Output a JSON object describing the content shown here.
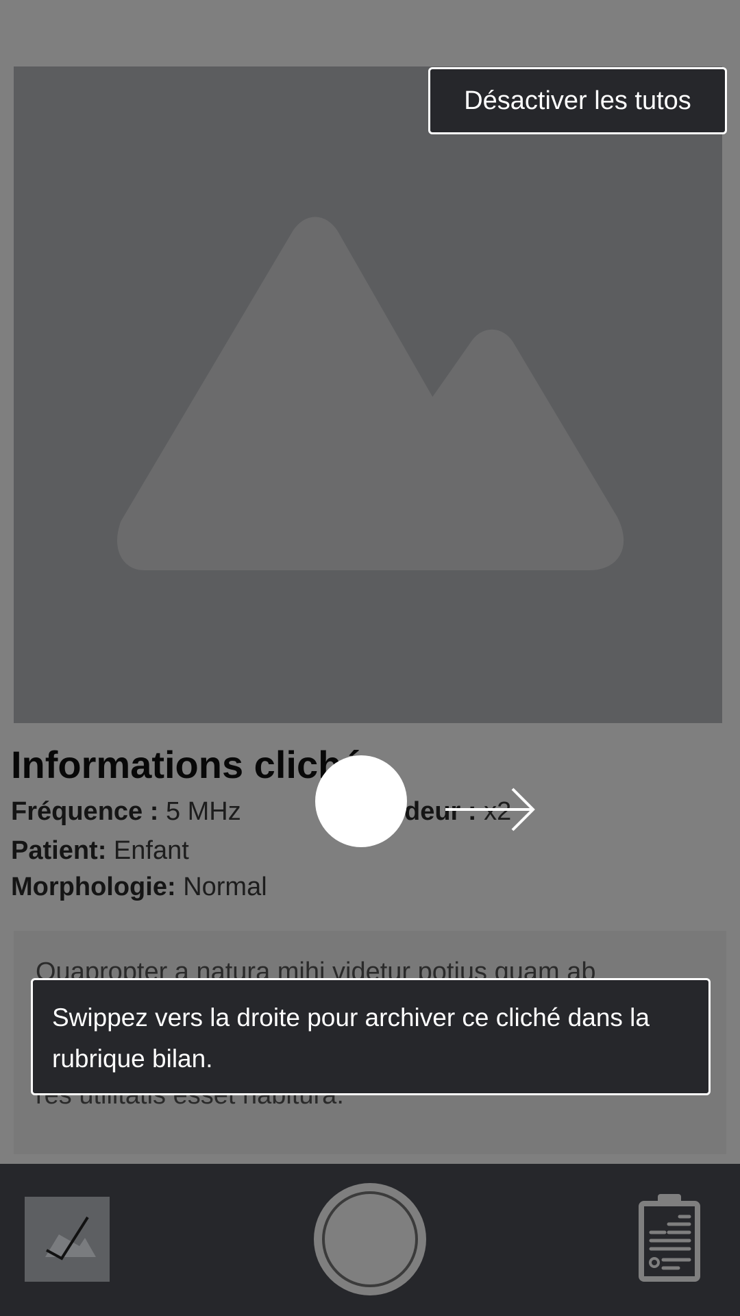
{
  "image_placeholder": {
    "icon": "mountain-image-icon"
  },
  "info": {
    "title": "Informations cliché",
    "frequency_label": "Fréquence :",
    "frequency_value": "5 MHz",
    "depth_label_fragment": "deur :",
    "depth_value": "x2",
    "patient_label": "Patient:",
    "patient_value": "Enfant",
    "morphology_label": "Morphologie:",
    "morphology_value": "Normal"
  },
  "description": {
    "visible_first_line": "Quapropter a natura mihi videtur potius quam ab",
    "visible_last_line": "res utilitatis esset habitura."
  },
  "tutorial": {
    "disable_button_label": "Désactiver les tutos",
    "swipe_hint": "Swippez vers la droite pour archiver ce cliché dans la rubrique bilan.",
    "gesture_icon": "swipe-right-arrow-icon"
  },
  "bottom_bar": {
    "left_icon": "image-check-icon",
    "center_icon": "capture-button",
    "right_icon": "clipboard-report-icon"
  },
  "colors": {
    "dark": "#26272b",
    "overlay": "rgba(0,0,0,0.5)",
    "white": "#ffffff"
  }
}
